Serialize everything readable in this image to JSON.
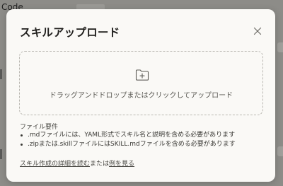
{
  "background": {
    "partial_text": "Code"
  },
  "modal": {
    "title": "スキルアップロード",
    "close_icon": "close-icon",
    "dropzone": {
      "icon": "folder-plus-icon",
      "text": "ドラッグアンドドロップまたはクリックしてアップロード"
    },
    "requirements": {
      "heading": "ファイル要件",
      "items": [
        ".mdファイルには、YAML形式でスキル名と説明を含める必要があります",
        ".zipまたは.skillファイルにはSKILL.mdファイルを含める必要があります"
      ]
    },
    "footer": {
      "link_details": "スキル作成の詳細を読む",
      "connector": "または",
      "link_example": "例を見る"
    }
  },
  "colors": {
    "overlay": "#8d8c88",
    "modal_bg": "#faf9f6",
    "text_primary": "#1f1e1c",
    "text_secondary": "#56554f",
    "dashed_border": "#b9b7b1"
  }
}
